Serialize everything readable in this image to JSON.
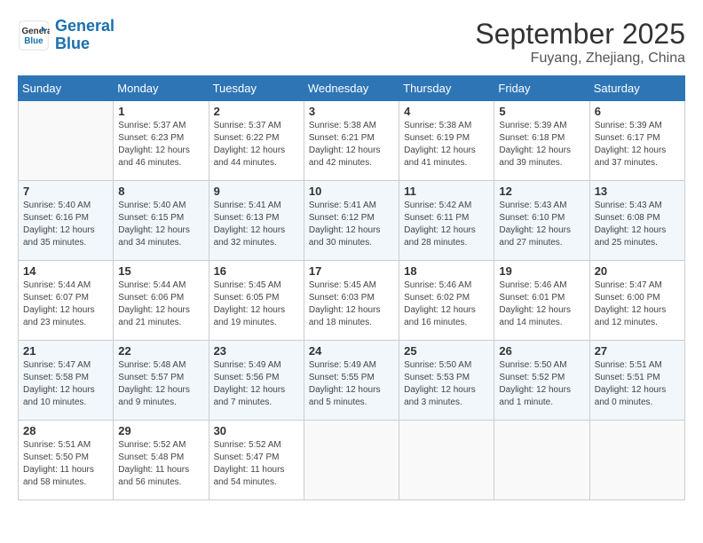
{
  "header": {
    "logo_line1": "General",
    "logo_line2": "Blue",
    "month": "September 2025",
    "location": "Fuyang, Zhejiang, China"
  },
  "weekdays": [
    "Sunday",
    "Monday",
    "Tuesday",
    "Wednesday",
    "Thursday",
    "Friday",
    "Saturday"
  ],
  "weeks": [
    [
      {
        "day": "",
        "info": ""
      },
      {
        "day": "1",
        "info": "Sunrise: 5:37 AM\nSunset: 6:23 PM\nDaylight: 12 hours\nand 46 minutes."
      },
      {
        "day": "2",
        "info": "Sunrise: 5:37 AM\nSunset: 6:22 PM\nDaylight: 12 hours\nand 44 minutes."
      },
      {
        "day": "3",
        "info": "Sunrise: 5:38 AM\nSunset: 6:21 PM\nDaylight: 12 hours\nand 42 minutes."
      },
      {
        "day": "4",
        "info": "Sunrise: 5:38 AM\nSunset: 6:19 PM\nDaylight: 12 hours\nand 41 minutes."
      },
      {
        "day": "5",
        "info": "Sunrise: 5:39 AM\nSunset: 6:18 PM\nDaylight: 12 hours\nand 39 minutes."
      },
      {
        "day": "6",
        "info": "Sunrise: 5:39 AM\nSunset: 6:17 PM\nDaylight: 12 hours\nand 37 minutes."
      }
    ],
    [
      {
        "day": "7",
        "info": "Sunrise: 5:40 AM\nSunset: 6:16 PM\nDaylight: 12 hours\nand 35 minutes."
      },
      {
        "day": "8",
        "info": "Sunrise: 5:40 AM\nSunset: 6:15 PM\nDaylight: 12 hours\nand 34 minutes."
      },
      {
        "day": "9",
        "info": "Sunrise: 5:41 AM\nSunset: 6:13 PM\nDaylight: 12 hours\nand 32 minutes."
      },
      {
        "day": "10",
        "info": "Sunrise: 5:41 AM\nSunset: 6:12 PM\nDaylight: 12 hours\nand 30 minutes."
      },
      {
        "day": "11",
        "info": "Sunrise: 5:42 AM\nSunset: 6:11 PM\nDaylight: 12 hours\nand 28 minutes."
      },
      {
        "day": "12",
        "info": "Sunrise: 5:43 AM\nSunset: 6:10 PM\nDaylight: 12 hours\nand 27 minutes."
      },
      {
        "day": "13",
        "info": "Sunrise: 5:43 AM\nSunset: 6:08 PM\nDaylight: 12 hours\nand 25 minutes."
      }
    ],
    [
      {
        "day": "14",
        "info": "Sunrise: 5:44 AM\nSunset: 6:07 PM\nDaylight: 12 hours\nand 23 minutes."
      },
      {
        "day": "15",
        "info": "Sunrise: 5:44 AM\nSunset: 6:06 PM\nDaylight: 12 hours\nand 21 minutes."
      },
      {
        "day": "16",
        "info": "Sunrise: 5:45 AM\nSunset: 6:05 PM\nDaylight: 12 hours\nand 19 minutes."
      },
      {
        "day": "17",
        "info": "Sunrise: 5:45 AM\nSunset: 6:03 PM\nDaylight: 12 hours\nand 18 minutes."
      },
      {
        "day": "18",
        "info": "Sunrise: 5:46 AM\nSunset: 6:02 PM\nDaylight: 12 hours\nand 16 minutes."
      },
      {
        "day": "19",
        "info": "Sunrise: 5:46 AM\nSunset: 6:01 PM\nDaylight: 12 hours\nand 14 minutes."
      },
      {
        "day": "20",
        "info": "Sunrise: 5:47 AM\nSunset: 6:00 PM\nDaylight: 12 hours\nand 12 minutes."
      }
    ],
    [
      {
        "day": "21",
        "info": "Sunrise: 5:47 AM\nSunset: 5:58 PM\nDaylight: 12 hours\nand 10 minutes."
      },
      {
        "day": "22",
        "info": "Sunrise: 5:48 AM\nSunset: 5:57 PM\nDaylight: 12 hours\nand 9 minutes."
      },
      {
        "day": "23",
        "info": "Sunrise: 5:49 AM\nSunset: 5:56 PM\nDaylight: 12 hours\nand 7 minutes."
      },
      {
        "day": "24",
        "info": "Sunrise: 5:49 AM\nSunset: 5:55 PM\nDaylight: 12 hours\nand 5 minutes."
      },
      {
        "day": "25",
        "info": "Sunrise: 5:50 AM\nSunset: 5:53 PM\nDaylight: 12 hours\nand 3 minutes."
      },
      {
        "day": "26",
        "info": "Sunrise: 5:50 AM\nSunset: 5:52 PM\nDaylight: 12 hours\nand 1 minute."
      },
      {
        "day": "27",
        "info": "Sunrise: 5:51 AM\nSunset: 5:51 PM\nDaylight: 12 hours\nand 0 minutes."
      }
    ],
    [
      {
        "day": "28",
        "info": "Sunrise: 5:51 AM\nSunset: 5:50 PM\nDaylight: 11 hours\nand 58 minutes."
      },
      {
        "day": "29",
        "info": "Sunrise: 5:52 AM\nSunset: 5:48 PM\nDaylight: 11 hours\nand 56 minutes."
      },
      {
        "day": "30",
        "info": "Sunrise: 5:52 AM\nSunset: 5:47 PM\nDaylight: 11 hours\nand 54 minutes."
      },
      {
        "day": "",
        "info": ""
      },
      {
        "day": "",
        "info": ""
      },
      {
        "day": "",
        "info": ""
      },
      {
        "day": "",
        "info": ""
      }
    ]
  ]
}
